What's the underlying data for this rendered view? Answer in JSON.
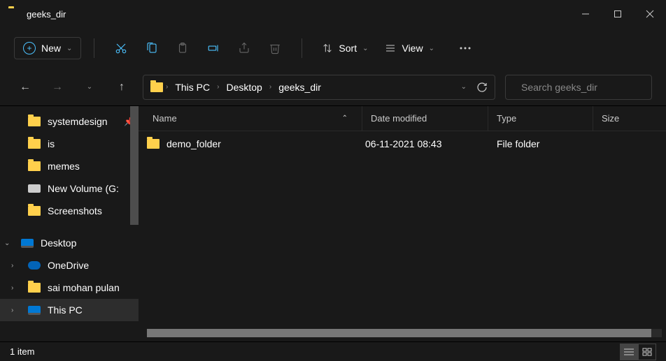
{
  "window": {
    "title": "geeks_dir"
  },
  "toolbar": {
    "new_label": "New",
    "sort_label": "Sort",
    "view_label": "View"
  },
  "breadcrumbs": [
    "This PC",
    "Desktop",
    "geeks_dir"
  ],
  "search": {
    "placeholder": "Search geeks_dir"
  },
  "sidebar": {
    "items": [
      {
        "label": "systemdesign",
        "icon": "folder",
        "level": 1,
        "pinned": true
      },
      {
        "label": "is",
        "icon": "folder",
        "level": 1
      },
      {
        "label": "memes",
        "icon": "folder",
        "level": 1
      },
      {
        "label": "New Volume (G:)",
        "icon": "disk",
        "level": 1,
        "truncated": "New Volume (G:"
      },
      {
        "label": "Screenshots",
        "icon": "folder",
        "level": 1
      },
      {
        "label": "Desktop",
        "icon": "pc",
        "level": 0,
        "expander": "down"
      },
      {
        "label": "OneDrive",
        "icon": "cloud",
        "level": 1,
        "expander": "right"
      },
      {
        "label": "sai mohan pulan",
        "icon": "folder",
        "level": 1,
        "expander": "right",
        "truncated": "sai mohan pulan"
      },
      {
        "label": "This PC",
        "icon": "pc",
        "level": 1,
        "expander": "right",
        "active": true
      }
    ]
  },
  "columns": {
    "name": "Name",
    "date": "Date modified",
    "type": "Type",
    "size": "Size"
  },
  "files": [
    {
      "name": "demo_folder",
      "date": "06-11-2021 08:43",
      "type": "File folder",
      "size": ""
    }
  ],
  "status": {
    "count": "1 item"
  }
}
